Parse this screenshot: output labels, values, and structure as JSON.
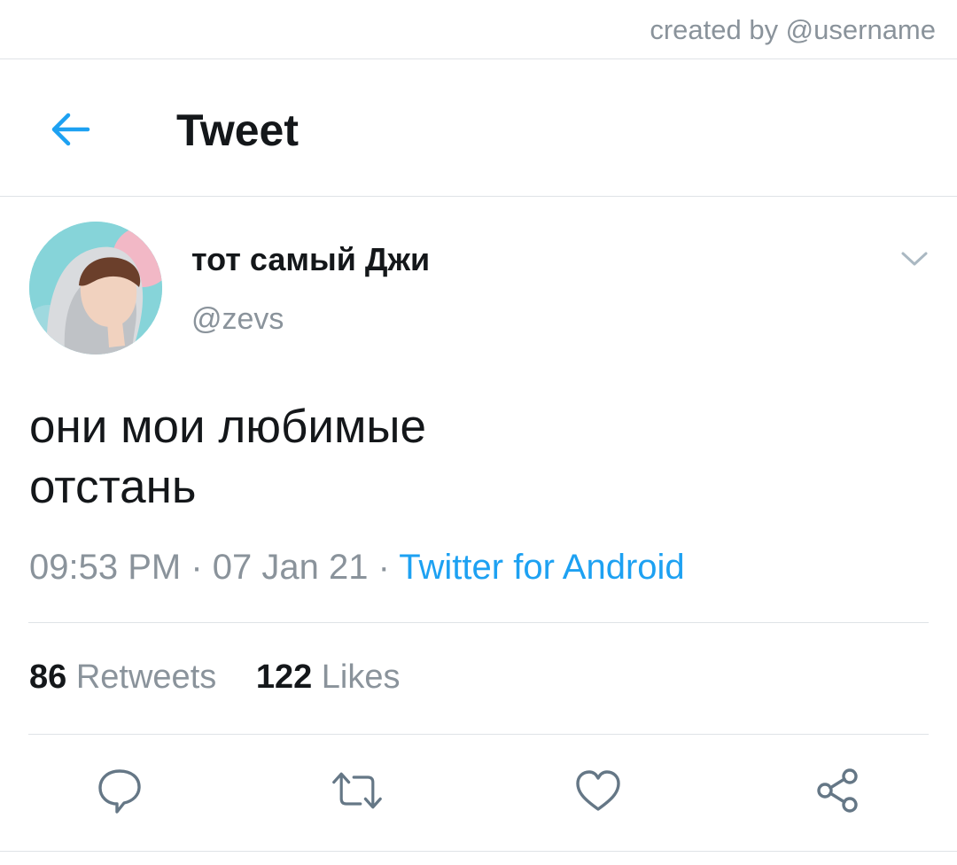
{
  "credit": "created by @username",
  "header": {
    "title": "Tweet",
    "back_icon": "arrow-left-icon"
  },
  "colors": {
    "accent": "#1da1f2",
    "muted": "#8a939b",
    "text": "#14171a",
    "divider": "#dfe3e7"
  },
  "tweet": {
    "display_name": "тот самый Джи",
    "handle": "@zevs",
    "menu_icon": "chevron-down-icon",
    "text_lines": [
      "они мои любимые",
      "отстань"
    ],
    "time": "09:53 PM",
    "separator": " · ",
    "date": "07 Jan 21",
    "source": "Twitter for Android"
  },
  "stats": {
    "retweets_count": "86",
    "retweets_label": "Retweets",
    "likes_count": "122",
    "likes_label": "Likes"
  },
  "actions": [
    "reply-icon",
    "retweet-icon",
    "like-icon",
    "share-icon"
  ]
}
